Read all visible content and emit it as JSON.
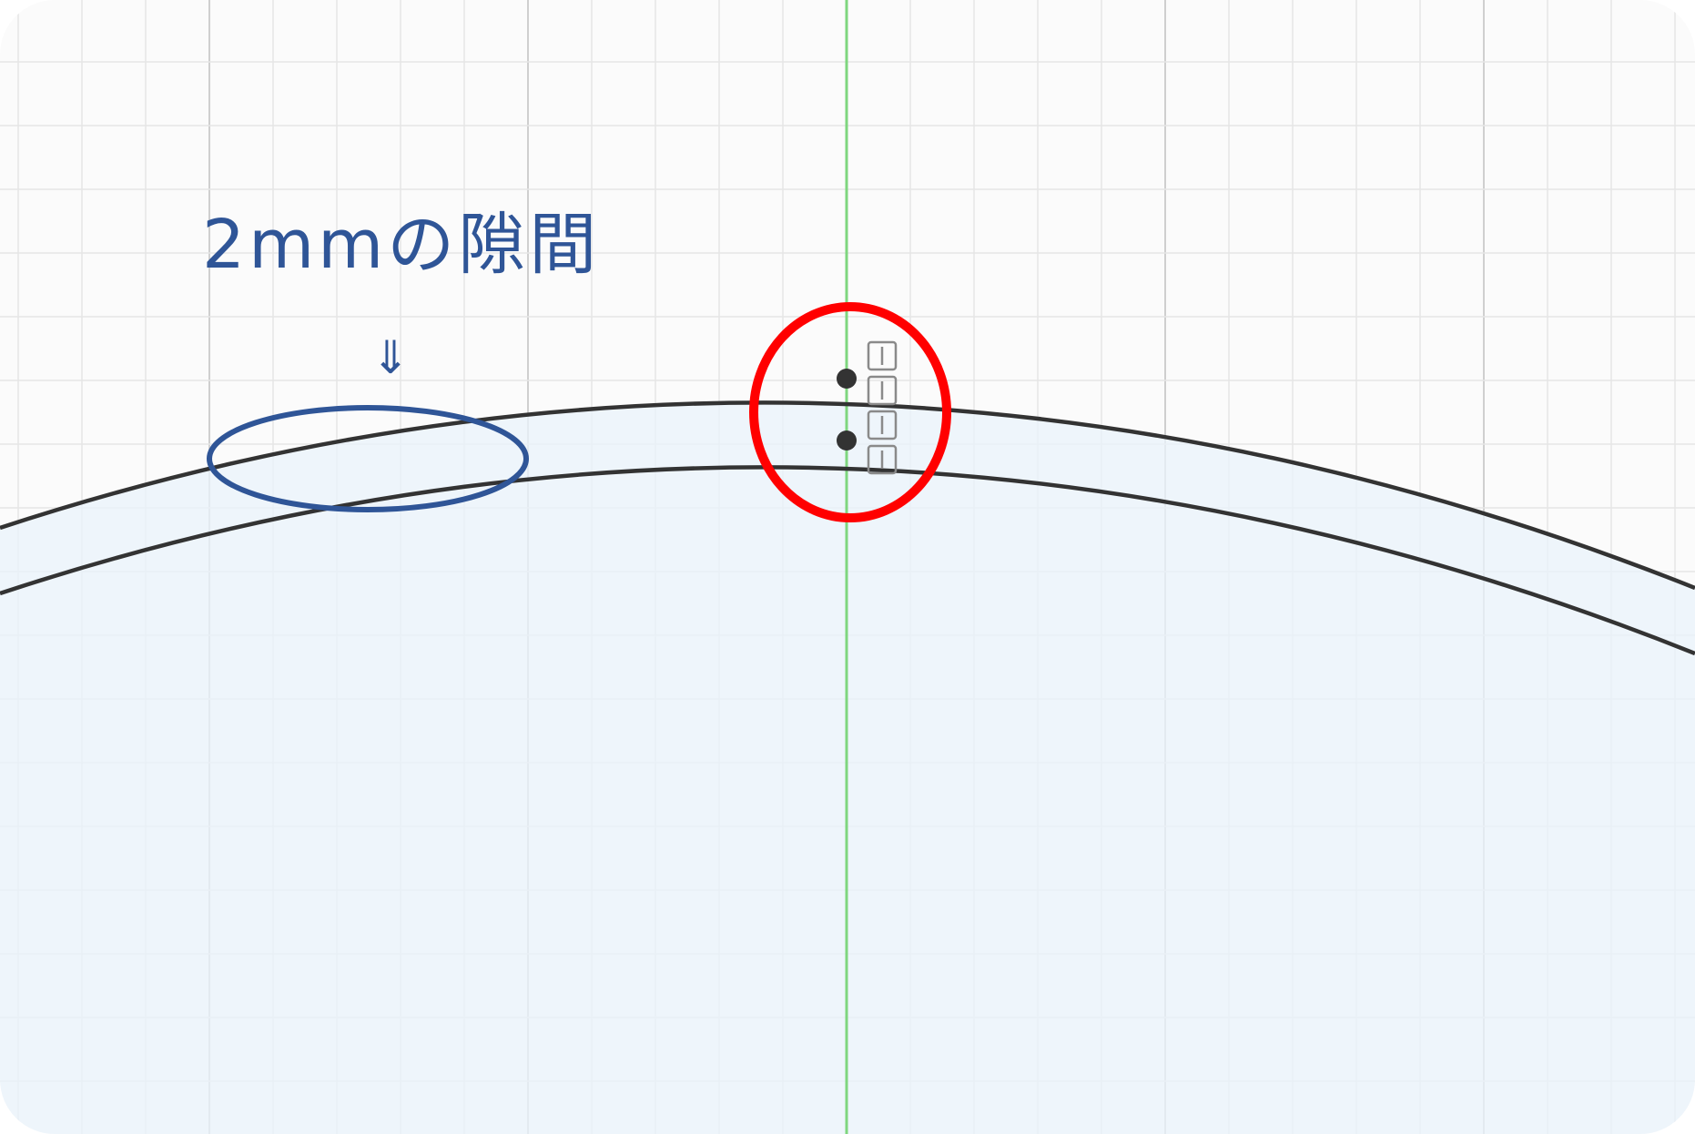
{
  "annotation": {
    "label": "2mmの隙間",
    "arrow": "⇓"
  },
  "colors": {
    "grid_minor": "#e6e6e6",
    "grid_major": "#cfcfcf",
    "axis_vertical": "#7fd67f",
    "curve": "#333333",
    "fill_region": "#eaf3fb",
    "annotation_blue": "#2f5597",
    "highlight_red": "#ff0000",
    "sketch_point": "#333333",
    "constraint_glyph": "#8a8a8a"
  },
  "icons": {
    "constraint": "vertical-constraint-icon"
  }
}
